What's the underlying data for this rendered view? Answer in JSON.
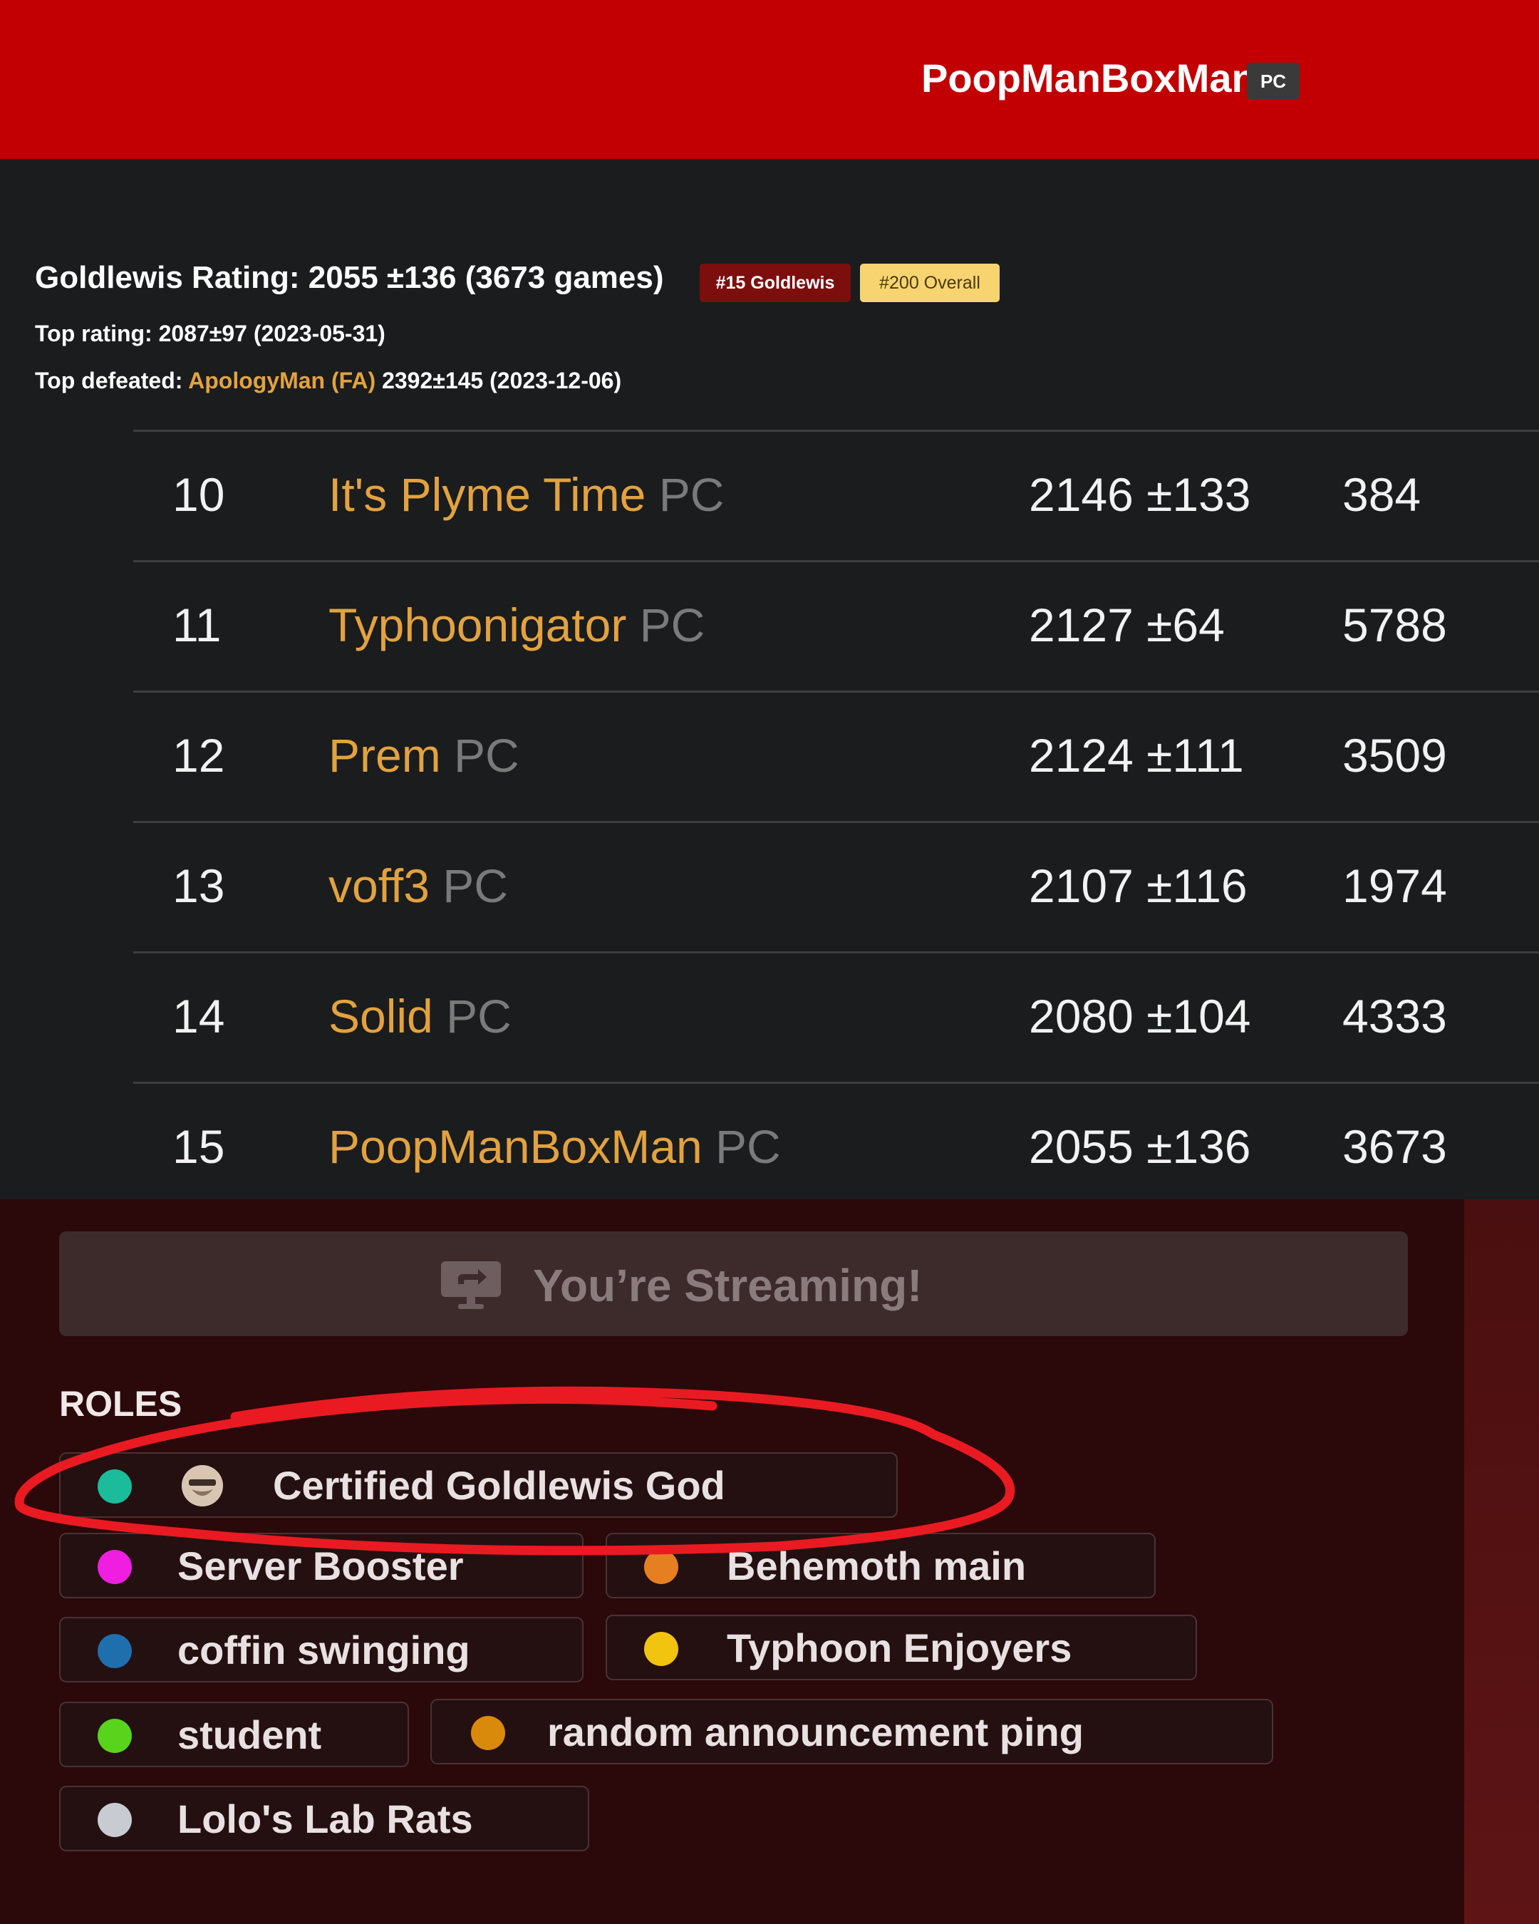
{
  "header": {
    "player_name": "PoopManBoxMan",
    "platform_badge": "PC"
  },
  "stats": {
    "rating_line": "Goldlewis Rating: 2055 ±136 (3673 games)",
    "rank_tag": "#15 Goldlewis",
    "overall_tag": "#200 Overall",
    "top_rating_label": "Top rating:",
    "top_rating_value": "2087±97 (2023-05-31)",
    "top_defeated_label": "Top defeated:",
    "top_defeated_name": "ApologyMan (FA)",
    "top_defeated_value": "2392±145 (2023-12-06)"
  },
  "leaderboard": [
    {
      "rank": "10",
      "name": "It's Plyme Time",
      "platform": "PC",
      "rating": "2146 ±133",
      "games": "384"
    },
    {
      "rank": "11",
      "name": "Typhoonigator",
      "platform": "PC",
      "rating": "2127 ±64",
      "games": "5788"
    },
    {
      "rank": "12",
      "name": "Prem",
      "platform": "PC",
      "rating": "2124 ±111",
      "games": "3509"
    },
    {
      "rank": "13",
      "name": "voff3",
      "platform": "PC",
      "rating": "2107 ±116",
      "games": "1974"
    },
    {
      "rank": "14",
      "name": "Solid",
      "platform": "PC",
      "rating": "2080 ±104",
      "games": "4333"
    },
    {
      "rank": "15",
      "name": "PoopManBoxMan",
      "platform": "PC",
      "rating": "2055 ±136",
      "games": "3673"
    }
  ],
  "discord": {
    "stream_banner": "You’re Streaming!",
    "roles_title": "ROLES",
    "roles": [
      {
        "label": "Certified Goldlewis God",
        "color": "#1abc9c"
      },
      {
        "label": "Server Booster",
        "color": "#f01ee0"
      },
      {
        "label": "Behemoth main",
        "color": "#e67e22"
      },
      {
        "label": "coffin swinging",
        "color": "#1f6fae"
      },
      {
        "label": "Typhoon Enjoyers",
        "color": "#f1c40f"
      },
      {
        "label": "student",
        "color": "#57d41b"
      },
      {
        "label": "random announcement ping",
        "color": "#d98a0a"
      },
      {
        "label": "Lolo's Lab Rats",
        "color": "#c8ccd2"
      }
    ]
  }
}
